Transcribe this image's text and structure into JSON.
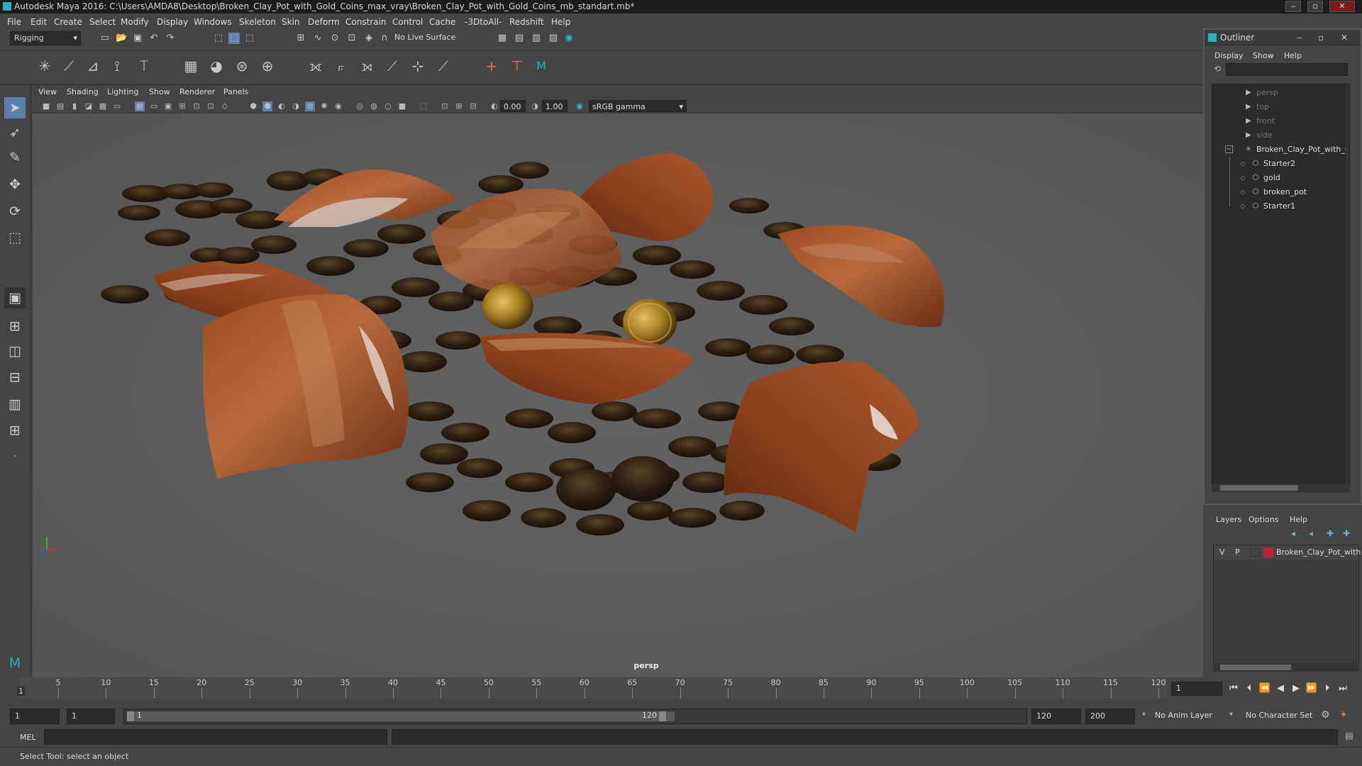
{
  "window": {
    "title": "Autodesk Maya 2016: C:\\Users\\AMDA8\\Desktop\\Broken_Clay_Pot_with_Gold_Coins_max_vray\\Broken_Clay_Pot_with_Gold_Coins_mb_standart.mb*"
  },
  "menubar": [
    "File",
    "Edit",
    "Create",
    "Select",
    "Modify",
    "Display",
    "Windows",
    "Skeleton",
    "Skin",
    "Deform",
    "Constrain",
    "Control",
    "Cache",
    "-3DtoAll-",
    "Redshift",
    "Help"
  ],
  "toolbar": {
    "mode": "Rigging",
    "live_surface": "No Live Surface"
  },
  "viewport": {
    "menu": [
      "View",
      "Shading",
      "Lighting",
      "Show",
      "Renderer",
      "Panels"
    ],
    "exposure": "0.00",
    "gamma": "1.00",
    "color_space": "sRGB gamma",
    "camera_label": "persp"
  },
  "outliner": {
    "title": "Outliner",
    "menu": [
      "Display",
      "Show",
      "Help"
    ],
    "items": [
      {
        "label": "persp",
        "icon": "camera-icon",
        "dim": true
      },
      {
        "label": "top",
        "icon": "camera-icon",
        "dim": true
      },
      {
        "label": "front",
        "icon": "camera-icon",
        "dim": true
      },
      {
        "label": "side",
        "icon": "camera-icon",
        "dim": true
      },
      {
        "label": "Broken_Clay_Pot_with_G",
        "icon": "group-icon",
        "dim": false
      },
      {
        "label": "Starter2",
        "icon": "mesh-icon",
        "dim": false
      },
      {
        "label": "gold",
        "icon": "mesh-icon",
        "dim": false
      },
      {
        "label": "broken_pot",
        "icon": "mesh-icon",
        "dim": false
      },
      {
        "label": "Starter1",
        "icon": "mesh-icon",
        "dim": false
      }
    ]
  },
  "layers": {
    "menu": [
      "Layers",
      "Options",
      "Help"
    ],
    "row": {
      "v": "V",
      "p": "P",
      "name": "Broken_Clay_Pot_with",
      "color": "#c0203a"
    }
  },
  "timeline": {
    "ticks": [
      "5",
      "10",
      "15",
      "20",
      "25",
      "30",
      "35",
      "40",
      "45",
      "50",
      "55",
      "60",
      "65",
      "70",
      "75",
      "80",
      "85",
      "90",
      "95",
      "100",
      "105",
      "110",
      "115",
      "120"
    ],
    "current_frame_marker": "1",
    "current_frame": "1"
  },
  "range": {
    "start": "1",
    "anim_start": "1",
    "slider_start": "1",
    "slider_end": "120",
    "end": "120",
    "anim_end": "200",
    "anim_layer": "No Anim Layer",
    "character_set": "No Character Set"
  },
  "cmdline": {
    "label": "MEL"
  },
  "helpline": {
    "text": "Select Tool: select an object"
  }
}
